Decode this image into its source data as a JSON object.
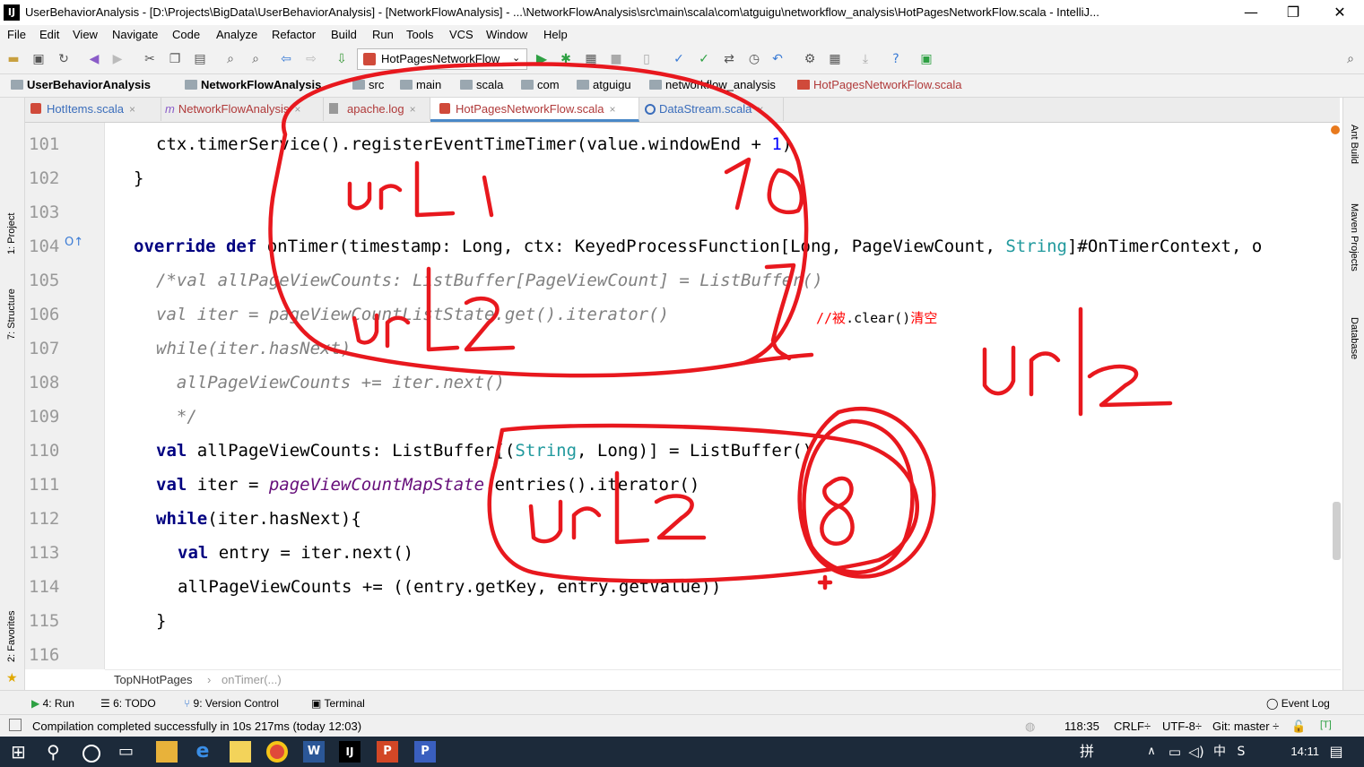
{
  "window": {
    "title": "UserBehaviorAnalysis - [D:\\Projects\\BigData\\UserBehaviorAnalysis] - [NetworkFlowAnalysis] - ...\\NetworkFlowAnalysis\\src\\main\\scala\\com\\atguigu\\networkflow_analysis\\HotPagesNetworkFlow.scala - IntelliJ...",
    "logo": "IJ",
    "controls": [
      "—",
      "❐",
      "✕"
    ]
  },
  "menu": [
    "File",
    "Edit",
    "View",
    "Navigate",
    "Code",
    "Analyze",
    "Refactor",
    "Build",
    "Run",
    "Tools",
    "VCS",
    "Window",
    "Help"
  ],
  "toolbar": {
    "run_config": "HotPagesNetworkFlow",
    "run_config_icon": "scala-object-icon"
  },
  "breadcrumbs": [
    "UserBehaviorAnalysis",
    "NetworkFlowAnalysis",
    "src",
    "main",
    "scala",
    "com",
    "atguigu",
    "networkflow_analysis",
    "HotPagesNetworkFlow.scala"
  ],
  "tabs": [
    {
      "label": "HotItems.scala",
      "active": false
    },
    {
      "label": "NetworkFlowAnalysis",
      "active": false
    },
    {
      "label": "apache.log",
      "active": false
    },
    {
      "label": "HotPagesNetworkFlow.scala",
      "active": true
    },
    {
      "label": "DataStream.scala",
      "active": false
    }
  ],
  "left_strip": {
    "project": "1: Project",
    "structure": "7: Structure",
    "favorites": "2: Favorites"
  },
  "right_strip": {
    "ant": "Ant Build",
    "maven": "Maven Projects",
    "database": "Database"
  },
  "editor": {
    "line_numbers": [
      "101",
      "102",
      "103",
      "104",
      "105",
      "106",
      "107",
      "108",
      "109",
      "110",
      "111",
      "112",
      "113",
      "114",
      "115",
      "116"
    ],
    "lines": {
      "l101": {
        "a": "ctx.timerService().registerEventTimeTimer(value.windowEnd + ",
        "b": "1",
        "c": ")"
      },
      "l102": "}",
      "l104": {
        "kw": "override def ",
        "a": "onTimer(timestamp: Long, ctx: KeyedProcessFunction[Long, PageViewCount, ",
        "ty": "String",
        "b": "]#OnTimerContext, o"
      },
      "l105": "/*val allPageViewCounts: ListBuffer[PageViewCount] = ListBuffer()",
      "l106": "val iter = pageViewCountListState.get().iterator()",
      "l107": "while(iter.hasNext)",
      "l108": "  allPageViewCounts += iter.next()",
      "l109": "  */",
      "l110": {
        "kw": "val ",
        "a": "allPageViewCounts: ListBuffer[(",
        "ty": "String",
        "b": ", Long)] = ListBuffer()"
      },
      "l111": {
        "kw": "val ",
        "a": "iter = ",
        "it": "pageViewCountMapState",
        "b": ".entries().iterator()"
      },
      "l112": {
        "kw": "while",
        "a": "(iter.hasNext){"
      },
      "l113": {
        "kw": "val ",
        "a": "entry = iter.next()"
      },
      "l114": "allPageViewCounts += ((entry.getKey, entry.getValue))",
      "l115": "}"
    },
    "inline_comment": {
      "a": "//被",
      "b": ".clear()",
      "c": "清空"
    },
    "footer_crumbs": [
      "TopNHotPages",
      "onTimer(...)"
    ]
  },
  "handwriting": [
    "url1",
    "10",
    "url2",
    "url2",
    "url2",
    "8"
  ],
  "tool_windows": [
    {
      "label": "4: Run",
      "icon": "run-icon"
    },
    {
      "label": "6: TODO",
      "icon": "todo-icon"
    },
    {
      "label": "9: Version Control",
      "icon": "vcs-icon"
    },
    {
      "label": "Terminal",
      "icon": "terminal-icon"
    }
  ],
  "event_log": "Event Log",
  "status": {
    "message": "Compilation completed successfully in 10s 217ms (today 12:03)",
    "position": "118:35",
    "line_sep": "CRLF÷",
    "encoding": "UTF-8÷",
    "git": "Git: master ÷"
  },
  "taskbar": {
    "time": "14:11"
  },
  "colors": {
    "annotation": "#e8181e",
    "keyword": "#000080",
    "type": "#20999d",
    "comment": "#808080",
    "number": "#0000ff",
    "taskbar": "#1c2a3a"
  }
}
